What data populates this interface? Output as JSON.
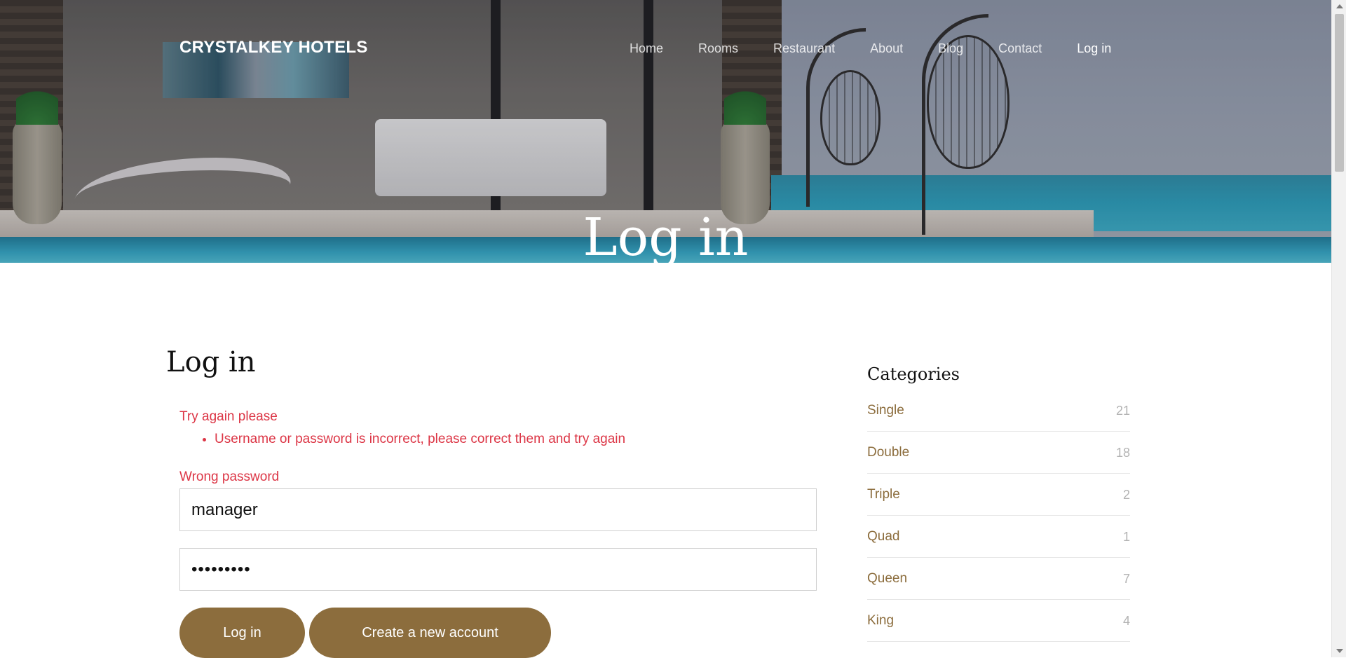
{
  "header": {
    "brand": "CRYSTALKEY HOTELS",
    "nav": [
      {
        "label": "Home"
      },
      {
        "label": "Rooms"
      },
      {
        "label": "Restaurant"
      },
      {
        "label": "About"
      },
      {
        "label": "Blog"
      },
      {
        "label": "Contact"
      },
      {
        "label": "Log in"
      }
    ],
    "hero_title": "Log in"
  },
  "login": {
    "title": "Log in",
    "error_heading": "Try again please",
    "errors": [
      "Username or password is incorrect, please correct them and try again"
    ],
    "field_error": "Wrong password",
    "username_value": "manager",
    "password_value": "•••••••••",
    "login_button": "Log in",
    "create_button": "Create a new account"
  },
  "sidebar": {
    "title": "Categories",
    "categories": [
      {
        "name": "Single",
        "count": "21"
      },
      {
        "name": "Double",
        "count": "18"
      },
      {
        "name": "Triple",
        "count": "2"
      },
      {
        "name": "Quad",
        "count": "1"
      },
      {
        "name": "Queen",
        "count": "7"
      },
      {
        "name": "King",
        "count": "4"
      }
    ]
  },
  "colors": {
    "accent": "#8c6d3d",
    "error": "#dc3545"
  }
}
